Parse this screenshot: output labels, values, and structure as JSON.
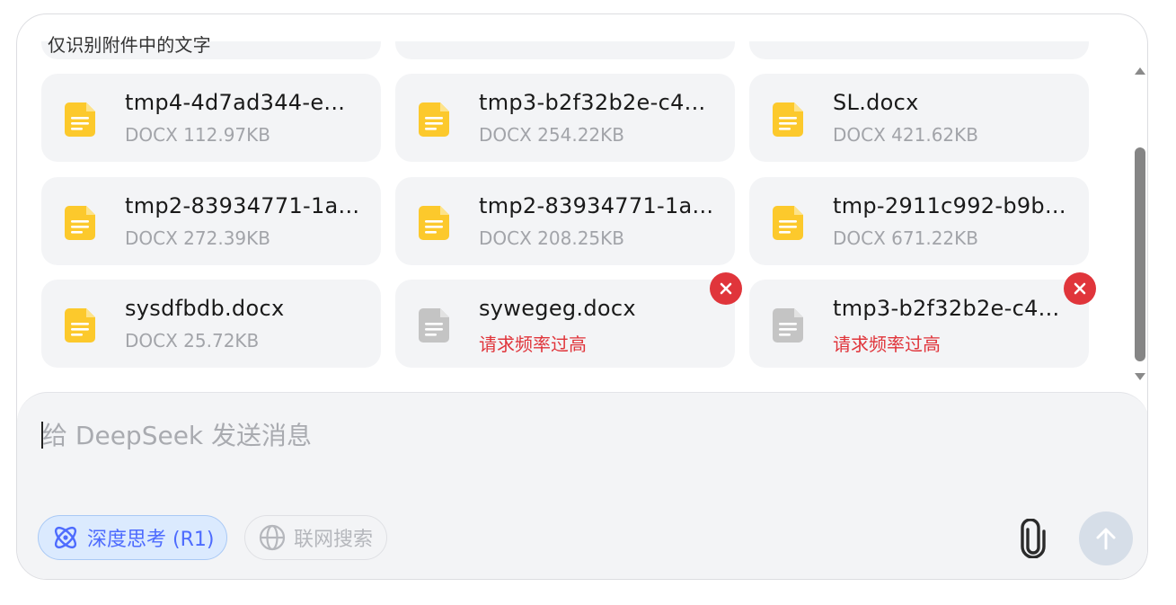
{
  "hint": "仅识别附件中的文字",
  "files": [
    {
      "name": "tmp4-4d7ad344-e...",
      "meta": "DOCX 112.97KB",
      "status": "ok"
    },
    {
      "name": "tmp3-b2f32b2e-c4...",
      "meta": "DOCX 254.22KB",
      "status": "ok"
    },
    {
      "name": "SL.docx",
      "meta": "DOCX 421.62KB",
      "status": "ok"
    },
    {
      "name": "tmp2-83934771-1a...",
      "meta": "DOCX 272.39KB",
      "status": "ok"
    },
    {
      "name": "tmp2-83934771-1a...",
      "meta": "DOCX 208.25KB",
      "status": "ok"
    },
    {
      "name": "tmp-2911c992-b9b...",
      "meta": "DOCX 671.22KB",
      "status": "ok"
    },
    {
      "name": "sysdfbdb.docx",
      "meta": "DOCX 25.72KB",
      "status": "ok"
    },
    {
      "name": "sywegeg.docx",
      "meta": "请求频率过高",
      "status": "error"
    },
    {
      "name": "tmp3-b2f32b2e-c4...",
      "meta": "请求频率过高",
      "status": "error"
    }
  ],
  "composer": {
    "placeholder": "给 DeepSeek 发送消息",
    "value": ""
  },
  "toolbar": {
    "deep_think_label": "深度思考 (R1)",
    "web_search_label": "联网搜索"
  },
  "icons": {
    "file_ok": "document-icon",
    "file_error": "document-icon",
    "remove": "close-icon",
    "deep_think": "atom-icon",
    "web_search": "globe-icon",
    "attach": "paperclip-icon",
    "send": "arrow-up-icon"
  },
  "colors": {
    "file_ok": "#fcc92c",
    "file_error": "#c4c4c4",
    "error_text": "#e0343a",
    "remove_button": "#e0353b",
    "accent": "#4d6bfe",
    "send_button": "#d6dee8"
  }
}
